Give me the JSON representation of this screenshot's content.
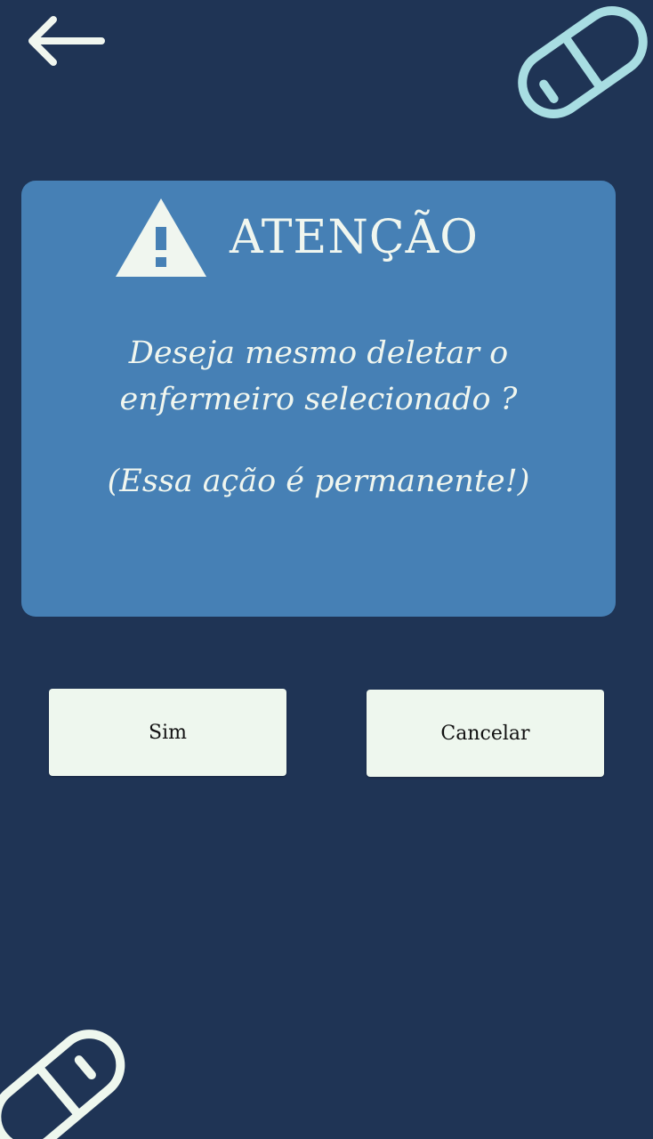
{
  "header": {
    "back_icon": "arrow-left-icon"
  },
  "decor": {
    "pill_icon": "pill-icon",
    "pill_color_top": "#a8dde2",
    "pill_color_bottom": "#eef7ee"
  },
  "dialog": {
    "icon": "warning-icon",
    "title": "ATENÇÃO",
    "message": "Deseja mesmo deletar o enfermeiro selecionado ?",
    "note": "(Essa ação é permanente!)",
    "background": "#4680b5"
  },
  "actions": {
    "confirm_label": "Sim",
    "cancel_label": "Cancelar"
  },
  "colors": {
    "background": "#1f3455",
    "text_light": "#f0f6ef",
    "button_bg": "#eef7ee"
  }
}
